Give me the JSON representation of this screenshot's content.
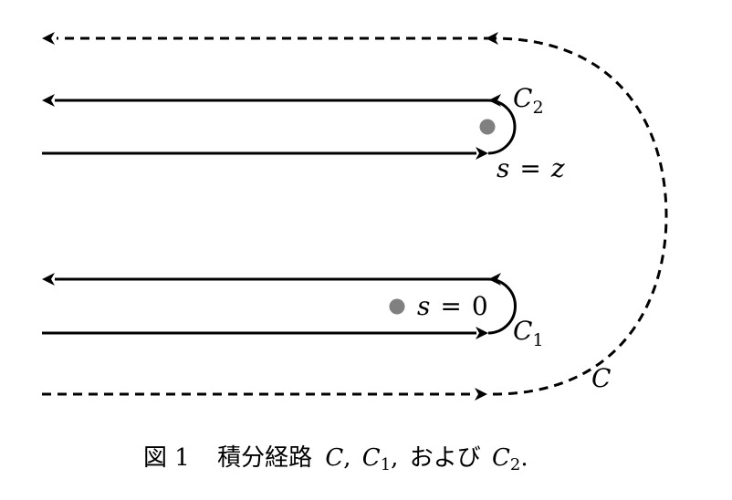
{
  "labels": {
    "c2": {
      "base": "C",
      "sub": "2"
    },
    "s_eq_z": {
      "lhs": "s",
      "op": "=",
      "rhs": "z"
    },
    "s_eq_0": {
      "lhs": "s",
      "op": "=",
      "rhs": "0"
    },
    "c1": {
      "base": "C",
      "sub": "1"
    },
    "c": {
      "base": "C"
    }
  },
  "caption": {
    "figure_label": "図 1",
    "title": "積分経路",
    "c": "C",
    "sep1": ",",
    "c1_base": "C",
    "c1_sub": "1",
    "sep2": ",",
    "and_text": "および",
    "c2_base": "C",
    "c2_sub": "2",
    "period": "."
  },
  "colors": {
    "line": "#000000",
    "pole": "#808080"
  }
}
